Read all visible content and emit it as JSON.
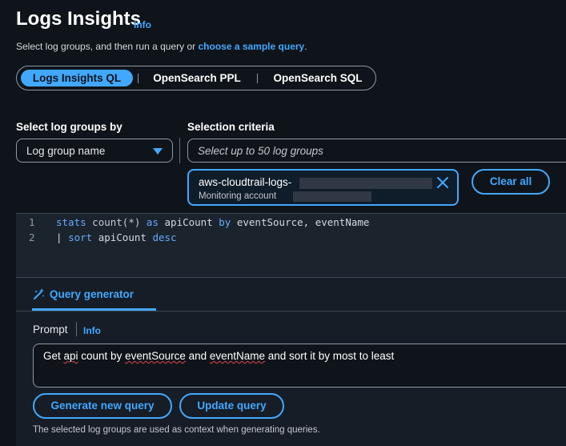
{
  "header": {
    "title": "Logs Insights",
    "info_label": "Info",
    "subtitle_prefix": "Select log groups, and then run a query or ",
    "subtitle_link": "choose a sample query",
    "subtitle_suffix": "."
  },
  "query_language": {
    "options": [
      "Logs Insights QL",
      "OpenSearch PPL",
      "OpenSearch SQL"
    ],
    "selected": "Logs Insights QL"
  },
  "log_group_selector": {
    "label": "Select log groups by",
    "value": "Log group name"
  },
  "selection_criteria": {
    "label": "Selection criteria",
    "placeholder": "Select up to 50 log groups",
    "token_name": "aws-cloudtrail-logs-",
    "token_account": "Monitoring account",
    "clear_all_label": "Clear all"
  },
  "editor": {
    "line_numbers": [
      "1",
      "2"
    ],
    "lines": [
      {
        "parts": [
          "stats",
          " ",
          "count(*)",
          " ",
          "as",
          " ",
          "apiCount",
          " ",
          "by",
          " ",
          "eventSource, eventName"
        ]
      },
      {
        "parts": [
          "|",
          " ",
          "sort",
          " ",
          "apiCount",
          " ",
          "desc"
        ]
      }
    ]
  },
  "query_generator": {
    "tab_label": "Query generator",
    "prompt_label": "Prompt",
    "prompt_info": "Info",
    "prompt_text_parts": [
      "Get ",
      "api",
      " count by ",
      "eventSource",
      " and ",
      "eventName",
      " and sort it by most to least"
    ],
    "generate_label": "Generate new query",
    "update_label": "Update query",
    "footnote": "The selected log groups are used as context when generating queries."
  },
  "colors": {
    "accent": "#42a8ff",
    "background": "#0f141a",
    "panel": "#161d26",
    "spellcheck": "#e0474c"
  }
}
